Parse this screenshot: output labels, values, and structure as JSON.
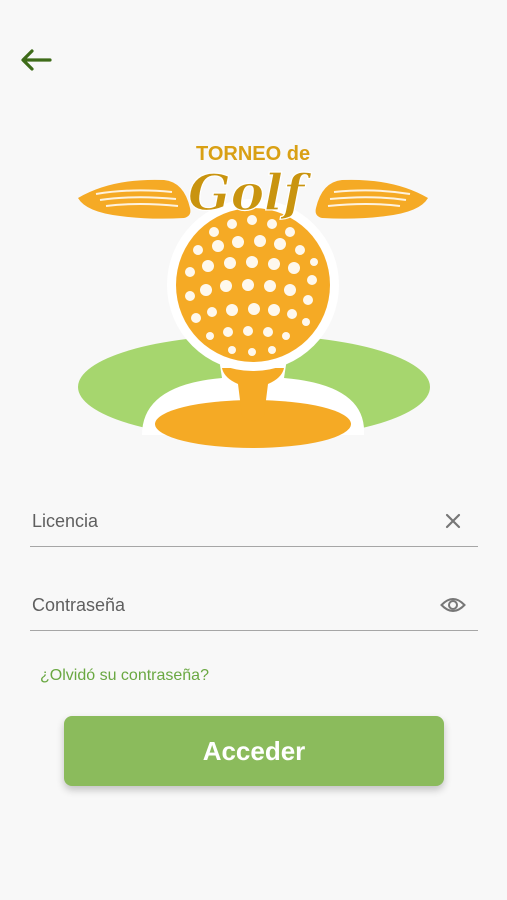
{
  "status_bar": {
    "time": "",
    "battery": ""
  },
  "icons": {
    "back": "arrow-left-icon",
    "clear": "close-icon",
    "visibility": "eye-icon"
  },
  "logo": {
    "line1": "TORNEO de",
    "line2": "Golf",
    "colors": {
      "gold": "#f5aa25",
      "green": "#a6d66e"
    }
  },
  "login_form": {
    "license_placeholder": "Licencia",
    "password_placeholder": "Contraseña",
    "forgot_password_link": "¿Olvidó su contraseña?",
    "submit_label": "Acceder"
  },
  "colors": {
    "accent": "#6aa842",
    "button": "#8bbb5c",
    "back_arrow": "#3e6b19"
  }
}
